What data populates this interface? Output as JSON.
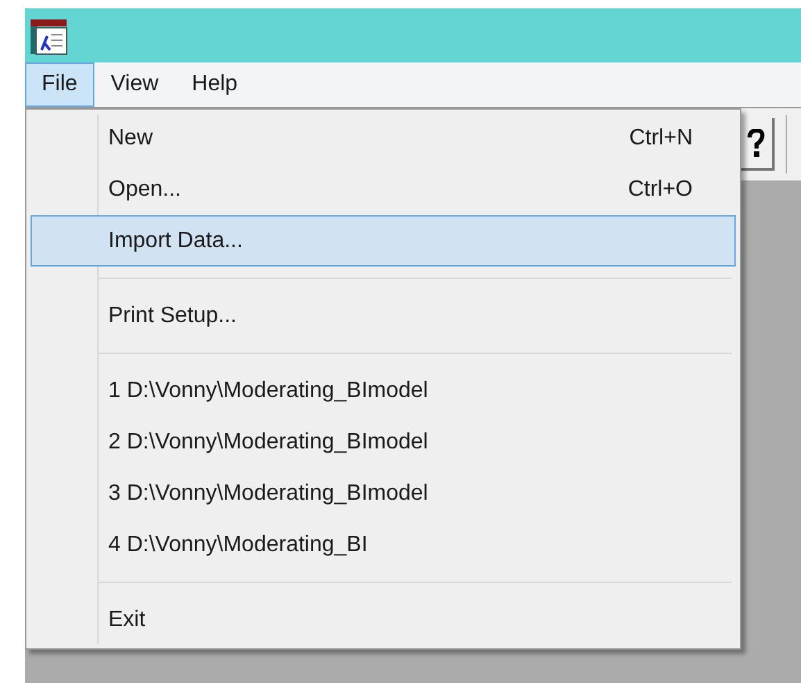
{
  "menu_bar": [
    {
      "label": "File",
      "selected": true
    },
    {
      "label": "View",
      "selected": false
    },
    {
      "label": "Help",
      "selected": false
    }
  ],
  "file_menu": [
    {
      "kind": "item",
      "label": "New",
      "shortcut": "Ctrl+N",
      "selected": false
    },
    {
      "kind": "item",
      "label": "Open...",
      "shortcut": "Ctrl+O",
      "selected": false
    },
    {
      "kind": "item",
      "label": "Import Data...",
      "selected": true
    },
    {
      "kind": "separator"
    },
    {
      "kind": "item",
      "label": "Print Setup...",
      "selected": false
    },
    {
      "kind": "separator"
    },
    {
      "kind": "item",
      "label": "1 D:\\Vonny\\Moderating_BImodel",
      "selected": false
    },
    {
      "kind": "item",
      "label": "2 D:\\Vonny\\Moderating_BImodel",
      "selected": false
    },
    {
      "kind": "item",
      "label": "3 D:\\Vonny\\Moderating_BImodel",
      "selected": false
    },
    {
      "kind": "item",
      "label": "4 D:\\Vonny\\Moderating_BI",
      "selected": false
    },
    {
      "kind": "separator"
    },
    {
      "kind": "item",
      "label": "Exit",
      "selected": false
    }
  ]
}
